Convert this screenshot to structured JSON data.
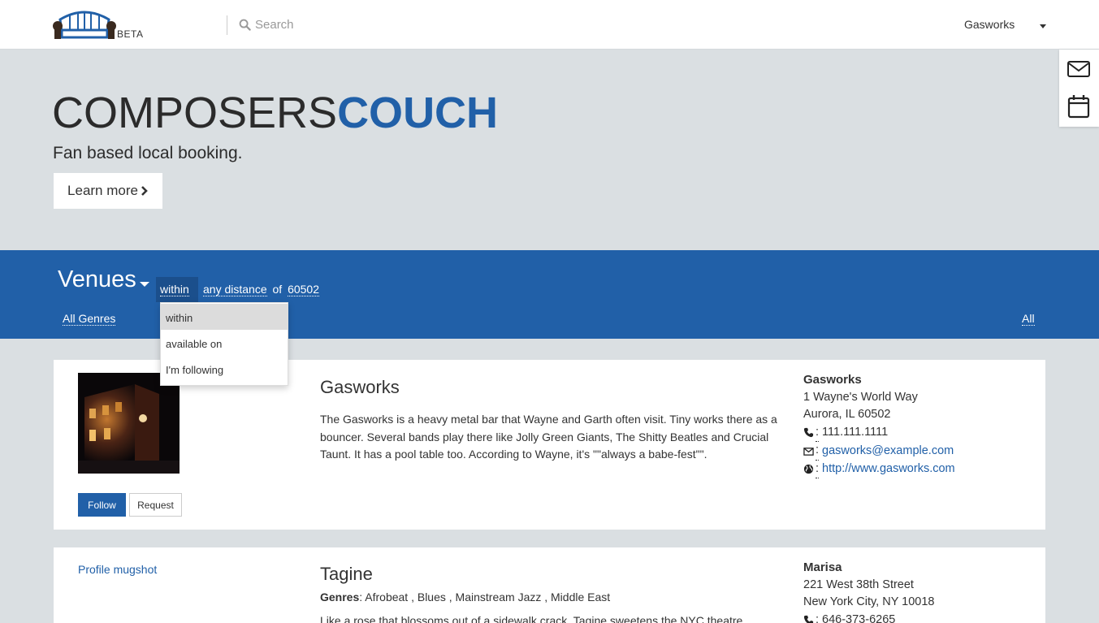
{
  "header": {
    "logo_icon": "couch-icon",
    "beta_label": "BETA",
    "search_placeholder": "Search",
    "user_name": "Gasworks"
  },
  "side_tools": {
    "messages_icon": "envelope-icon",
    "calendar_icon": "calendar-icon"
  },
  "hero": {
    "title_part1": "COMPOSERS",
    "title_part2": "COUCH",
    "subtitle": "Fan based local booking.",
    "learn_more_label": "Learn more",
    "accent_color": "#2160a8"
  },
  "filter_bar": {
    "section_label": "Venues",
    "mode_label": "within",
    "distance_label": "any distance",
    "of_label": "of",
    "zip_label": "60502",
    "genres_label": "All Genres",
    "all_label": "All"
  },
  "mode_dropdown": {
    "options": [
      "within",
      "available on",
      "I'm following"
    ],
    "selected": "within"
  },
  "venues": [
    {
      "name": "Gasworks",
      "description": "The Gasworks is a heavy metal bar that Wayne and Garth often visit. Tiny works there as a bouncer. Several bands play there like Jolly Green Giants, The Shitty Beatles and Crucial Taunt. It has a pool table too. According to Wayne, it's \"\"always a babe-fest\"\".",
      "follow_label": "Follow",
      "request_label": "Request",
      "contact": {
        "name": "Gasworks",
        "street": "1 Wayne's World Way",
        "city": "Aurora, IL 60502",
        "phone": "111.111.1111",
        "email": "gasworks@example.com",
        "website": "http://www.gasworks.com"
      }
    },
    {
      "name": "Tagine",
      "photo_alt": "Profile mugshot",
      "genres_label": "Genres",
      "genres": "Afrobeat , Blues , Mainstream Jazz , Middle East",
      "description": "Like a rose that blossoms out of a sidewalk crack, Tagine sweetens the NYC theatre",
      "contact": {
        "name": "Marisa",
        "street": "221 West 38th Street",
        "city": "New York City, NY 10018",
        "phone": "646-373-6265"
      }
    }
  ]
}
